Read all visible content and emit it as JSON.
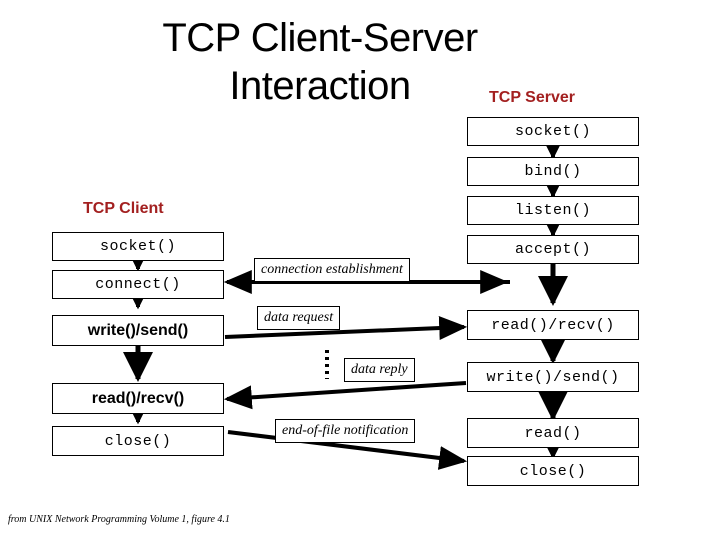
{
  "slide": {
    "title": "TCP Client-Server Interaction",
    "credit": "from UNIX Network Programming Volume 1, figure 4.1",
    "background_color": "#FFFFFF",
    "heading_color": "#A32020"
  },
  "client": {
    "heading": "TCP Client",
    "steps": [
      {
        "label": "socket()",
        "style": "mono"
      },
      {
        "label": "connect()",
        "style": "mono"
      },
      {
        "label": "write()/send()",
        "style": "bold-sans"
      },
      {
        "label": "read()/recv()",
        "style": "bold-sans"
      },
      {
        "label": "close()",
        "style": "mono"
      }
    ]
  },
  "server": {
    "heading": "TCP Server",
    "steps": [
      {
        "label": "socket()",
        "style": "mono"
      },
      {
        "label": "bind()",
        "style": "mono"
      },
      {
        "label": "listen()",
        "style": "mono"
      },
      {
        "label": "accept()",
        "style": "mono"
      },
      {
        "label": "read()/recv()",
        "style": "mono"
      },
      {
        "label": "write()/send()",
        "style": "mono"
      },
      {
        "label": "read()",
        "style": "mono"
      },
      {
        "label": "close()",
        "style": "mono"
      }
    ]
  },
  "messages": [
    {
      "label": "connection establishment",
      "direction": "bidirectional"
    },
    {
      "label": "data request",
      "direction": "client-to-server"
    },
    {
      "label": "data reply",
      "direction": "server-to-client"
    },
    {
      "label": "end-of-file notification",
      "direction": "client-to-server"
    }
  ]
}
